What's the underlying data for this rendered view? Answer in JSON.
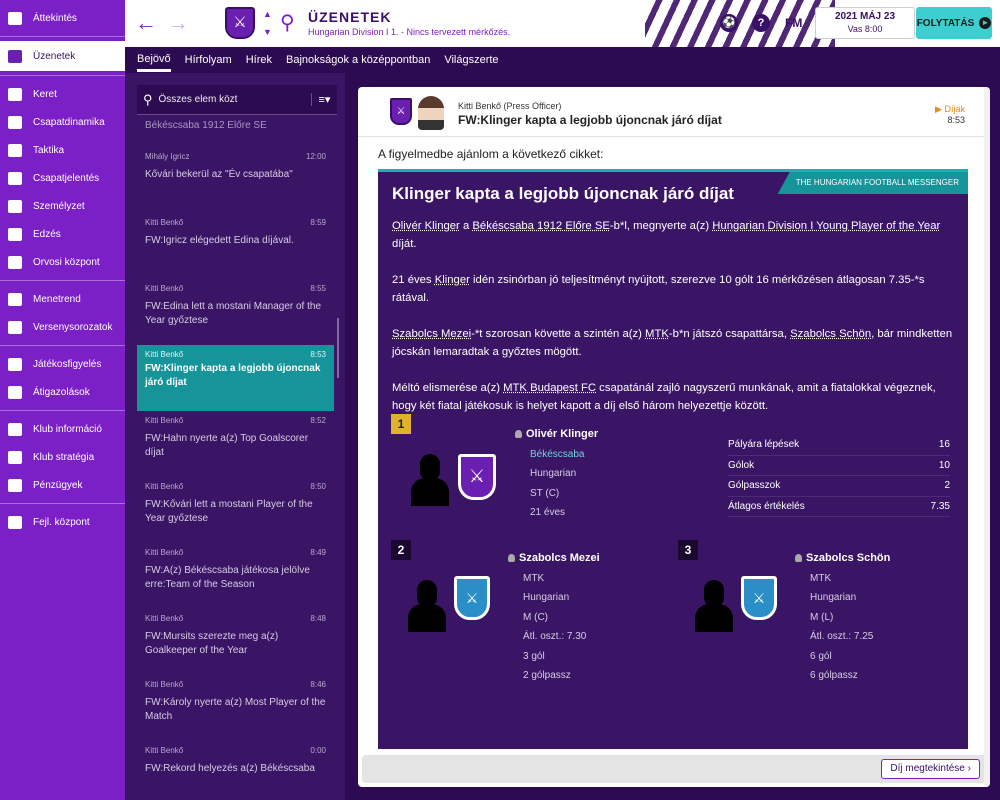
{
  "sidebar": {
    "items": [
      {
        "label": "Áttekintés",
        "icon": "home-icon"
      },
      {
        "label": "Üzenetek",
        "icon": "inbox-icon"
      },
      {
        "label": "Keret",
        "icon": "squad-icon"
      },
      {
        "label": "Csapatdinamika",
        "icon": "dynamics-icon"
      },
      {
        "label": "Taktika",
        "icon": "tactics-icon"
      },
      {
        "label": "Csapatjelentés",
        "icon": "report-icon"
      },
      {
        "label": "Személyzet",
        "icon": "staff-icon"
      },
      {
        "label": "Edzés",
        "icon": "training-icon"
      },
      {
        "label": "Orvosi központ",
        "icon": "medical-icon"
      },
      {
        "label": "Menetrend",
        "icon": "calendar-icon"
      },
      {
        "label": "Versenysorozatok",
        "icon": "trophy-icon"
      },
      {
        "label": "Játékosfigyelés",
        "icon": "scouting-icon"
      },
      {
        "label": "Átigazolások",
        "icon": "transfers-icon"
      },
      {
        "label": "Klub információ",
        "icon": "club-info-icon"
      },
      {
        "label": "Klub stratégia",
        "icon": "strategy-icon"
      },
      {
        "label": "Pénzügyek",
        "icon": "finances-icon"
      },
      {
        "label": "Fejl. központ",
        "icon": "development-icon"
      }
    ]
  },
  "topbar": {
    "title": "ÜZENETEK",
    "subtitle": "Hungarian Division I 1. - Nincs tervezett mérkőzés.",
    "fm_label": "FM",
    "date": "2021 MÁJ 23",
    "time": "Vas 8:00",
    "continue_label": "FOLYTATÁS",
    "help": "?"
  },
  "tabs": [
    "Bejövő",
    "Hírfolyam",
    "Hírek",
    "Bajnokságok a középpontban",
    "Világszerte"
  ],
  "list": {
    "search_placeholder": "Összes elem közt",
    "top_partial": "Békéscsaba 1912 Előre SE",
    "messages": [
      {
        "sender": "Mihály Igricz",
        "time": "12:00",
        "subject": "Kővári bekerül az \"Év csapatába\""
      },
      {
        "sender": "Kitti Benkő",
        "time": "8:59",
        "subject": "FW:Igricz elégedett Edina díjával."
      },
      {
        "sender": "Kitti Benkő",
        "time": "8:55",
        "subject": "FW:Edina lett a mostani Manager of the Year győztese"
      },
      {
        "sender": "Kitti Benkő",
        "time": "8:53",
        "subject": "FW:Klinger kapta a legjobb újoncnak járó díjat"
      },
      {
        "sender": "Kitti Benkő",
        "time": "8:52",
        "subject": "FW:Hahn nyerte a(z) Top Goalscorer díjat"
      },
      {
        "sender": "Kitti Benkő",
        "time": "8:50",
        "subject": "FW:Kővári lett a mostani Player of the Year győztese"
      },
      {
        "sender": "Kitti Benkő",
        "time": "8:49",
        "subject": "FW:A(z) Békéscsaba játékosa jelölve erre:Team of the Season"
      },
      {
        "sender": "Kitti Benkő",
        "time": "8:48",
        "subject": "FW:Mursits szerezte meg a(z) Goalkeeper of the Year"
      },
      {
        "sender": "Kitti Benkő",
        "time": "8:46",
        "subject": "FW:Károly nyerte a(z) Most Player of the Match"
      },
      {
        "sender": "Kitti Benkő",
        "time": "0:00",
        "subject": "FW:Rekord helyezés a(z) Békéscsaba"
      }
    ]
  },
  "detail": {
    "sender": "Kitti Benkő  (Press Officer)",
    "subject": "FW:Klinger kapta a legjobb újoncnak járó díjat",
    "tag": "Díjak",
    "time": "8:53",
    "intro": "A figyelmedbe ajánlom a következő cikket:",
    "article": {
      "title": "Klinger kapta a legjobb újoncnak járó díjat",
      "source": "THE HUNGARIAN FOOTBALL MESSENGER",
      "p1": {
        "a": "Olivér Klinger",
        "b": " a ",
        "c": "Békéscsaba 1912 Előre SE",
        "d": "-b*l, megnyerte a(z) ",
        "e": "Hungarian Division I Young Player of the Year",
        "f": " díját."
      },
      "p2": {
        "a": "21 éves ",
        "b": "Klinger",
        "c": " idén zsinórban jó teljesítményt nyújtott, szerezve 10 gólt 16 mérkőzésen átlagosan 7.35-*s rátával."
      },
      "p3": {
        "a": "Szabolcs Mezei",
        "b": "-*t szorosan követte a szintén a(z) ",
        "c": "MTK",
        "d": "-b*n játszó csapattársa, ",
        "e": "Szabolcs Schön",
        "f": ", bár mindketten jócskán lemaradtak a győztes mögött."
      },
      "p4": {
        "a": "Méltó elismerése a(z) ",
        "b": "MTK Budapest FC",
        "c": " csapatánál zajló nagyszerű munkának, amit a fiatalokkal végeznek, hogy két fiatal játékosuk is helyet kapott a díj első három helyezettje között."
      }
    },
    "winner": {
      "rank": "1",
      "name": "Olivér Klinger",
      "club": "Békéscsaba",
      "nationality": "Hungarian",
      "position": "ST (C)",
      "age": "21 éves",
      "stats": [
        {
          "label": "Pályára lépések",
          "value": "16"
        },
        {
          "label": "Gólok",
          "value": "10"
        },
        {
          "label": "Gólpasszok",
          "value": "2"
        },
        {
          "label": "Átlagos értékelés",
          "value": "7.35"
        }
      ]
    },
    "second": {
      "rank": "2",
      "name": "Szabolcs Mezei",
      "club": "MTK",
      "nationality": "Hungarian",
      "position": "M (C)",
      "rating": "Átl. oszt.: 7.30",
      "goals": "3 gól",
      "assists": "2 gólpassz"
    },
    "third": {
      "rank": "3",
      "name": "Szabolcs Schön",
      "club": "MTK",
      "nationality": "Hungarian",
      "position": "M (L)",
      "rating": "Átl. oszt.: 7.25",
      "goals": "6 gól",
      "assists": "6 gólpassz"
    },
    "award_button": "Díj megtekintése"
  },
  "colors": {
    "sidebar": "#7b1fc6",
    "dark": "#2d0b52",
    "accent": "#3dcfd0",
    "selected": "#17939a",
    "gold": "#e0b32a"
  }
}
